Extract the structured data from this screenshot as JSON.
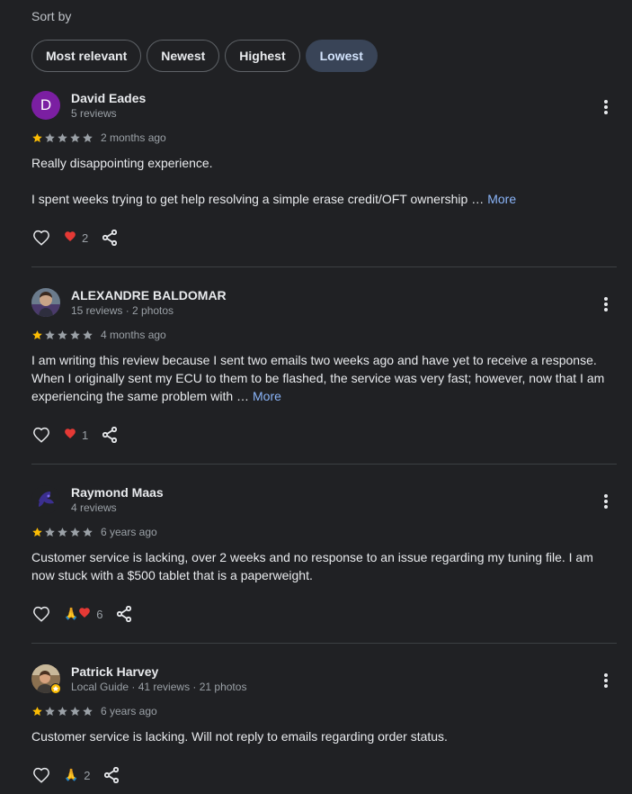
{
  "sort": {
    "label": "Sort by",
    "options": [
      "Most relevant",
      "Newest",
      "Highest",
      "Lowest"
    ],
    "selected": "Lowest"
  },
  "colors": {
    "background": "#202124",
    "chip_selected_bg": "#394457",
    "star_filled": "#fbbc04",
    "star_empty": "#9aa0a6",
    "link": "#8ab4f8",
    "heart": "#e53935"
  },
  "reviews": [
    {
      "author": "David Eades",
      "avatar_letter": "D",
      "meta": "5 reviews",
      "rating": 1,
      "date": "2 months ago",
      "text_lines": [
        "Really disappointing experience.",
        "I spent weeks trying to get help resolving a simple erase credit/OFT ownership …"
      ],
      "more_label": "More",
      "reactions": [
        "heart"
      ],
      "reaction_count": "2"
    },
    {
      "author": "ALEXANDRE BALDOMAR",
      "meta": "15 reviews · 2 photos",
      "rating": 1,
      "date": "4 months ago",
      "text_lines": [
        "I am writing this review because I sent two emails two weeks ago and have yet to receive a response. When I originally sent my ECU to them to be flashed, the service was very fast; however, now that I am experiencing the same problem with …"
      ],
      "more_label": "More",
      "reactions": [
        "heart"
      ],
      "reaction_count": "1"
    },
    {
      "author": "Raymond Maas",
      "meta": "4 reviews",
      "rating": 1,
      "date": "6 years ago",
      "text_lines": [
        "Customer service is lacking, over 2 weeks and no response to an issue regarding my tuning file. I am now stuck with a $500 tablet that is a paperweight."
      ],
      "more_label": "",
      "reactions": [
        "pray",
        "heart"
      ],
      "reaction_count": "6"
    },
    {
      "author": "Patrick Harvey",
      "meta": "Local Guide · 41 reviews · 21 photos",
      "rating": 1,
      "date": "6 years ago",
      "text_lines": [
        "Customer service is lacking. Will not reply to emails regarding order status."
      ],
      "more_label": "",
      "reactions": [
        "pray"
      ],
      "reaction_count": "2"
    }
  ]
}
